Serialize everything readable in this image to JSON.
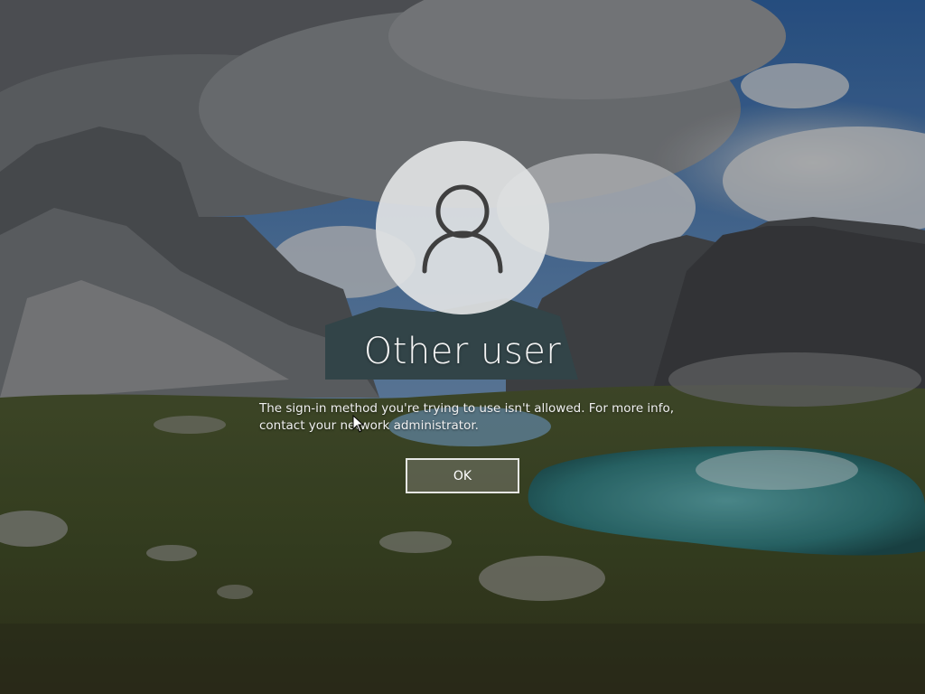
{
  "screen": {
    "type": "windows-lock-screen-sign-in-error",
    "accent_colors": {
      "sky": "#2f5a8f",
      "mountain": "#4b4e52",
      "grass": "#4a5a2c",
      "lake": "#3f8e90",
      "avatar_circle": "#e1e3e4",
      "avatar_glyph": "#3f3f3f"
    }
  },
  "user": {
    "name": "Other user",
    "avatar_icon": "user-silhouette-icon"
  },
  "dialog": {
    "message": "The sign-in method you're trying to use isn't allowed. For more info, contact your network administrator.",
    "ok_label": "OK"
  }
}
